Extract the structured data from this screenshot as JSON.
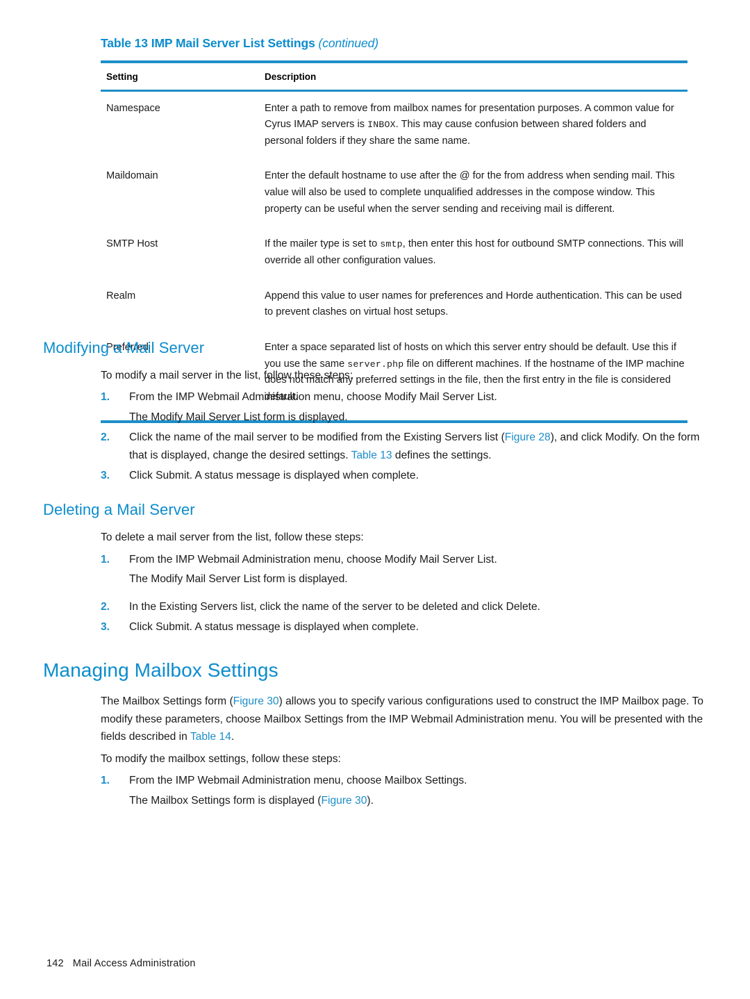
{
  "table": {
    "caption_main": "Table 13 IMP Mail Server List Settings",
    "caption_continued": "(continued)",
    "columns": [
      "Setting",
      "Description"
    ],
    "rows": [
      {
        "setting": "Namespace",
        "desc_part1": "Enter a path to remove from mailbox names for presentation purposes. A common value for Cyrus IMAP servers is ",
        "desc_code": "INBOX",
        "desc_part2": ". This may cause confusion between shared folders and personal folders if they share the same name."
      },
      {
        "setting": "Maildomain",
        "desc_part1": "Enter the default hostname to use after the @ for the from address when sending mail. This value will also be used to complete unqualified addresses in the compose window. This property can be useful when the server sending and receiving mail is different.",
        "desc_code": "",
        "desc_part2": ""
      },
      {
        "setting": "SMTP Host",
        "desc_part1": "If the mailer type is set to ",
        "desc_code": "smtp",
        "desc_part2": ", then enter this host for outbound SMTP connections. This will override all other configuration values."
      },
      {
        "setting": "Realm",
        "desc_part1": "Append this value to user names for preferences and Horde authentication. This can be used to prevent clashes on virtual host setups.",
        "desc_code": "",
        "desc_part2": ""
      },
      {
        "setting": "Preferred",
        "desc_part1": "Enter a space separated list of hosts on which this server entry should be default. Use this if you use the same ",
        "desc_code": "server.php",
        "desc_part2": " file on different machines. If the hostname of the IMP machine does not match any preferred settings in the file, then the first entry in the file is considered default."
      }
    ]
  },
  "modifying": {
    "heading": "Modifying a Mail Server",
    "intro": "To modify a mail server in the list, follow these steps:",
    "step1_num": "1.",
    "step1_text": "From the IMP Webmail Administration menu, choose Modify Mail Server List.",
    "step1_sub": "The Modify Mail Server List form is displayed.",
    "step2_num": "2.",
    "step2_a": "Click the name of the mail server to be modified from the Existing Servers list (",
    "step2_xref1": "Figure 28",
    "step2_b": "), and click Modify. On the form that is displayed, change the desired settings. ",
    "step2_xref2": "Table 13",
    "step2_c": " defines the settings.",
    "step3_num": "3.",
    "step3_text": "Click Submit. A status message is displayed when complete."
  },
  "deleting": {
    "heading": "Deleting a Mail Server",
    "intro": "To delete a mail server from the list, follow these steps:",
    "step1_num": "1.",
    "step1_text": "From the IMP Webmail Administration menu, choose Modify Mail Server List.",
    "step1_sub": "The Modify Mail Server List form is displayed.",
    "step2_num": "2.",
    "step2_text": "In the Existing Servers list, click the name of the server to be deleted and click Delete.",
    "step3_num": "3.",
    "step3_text": "Click Submit. A status message is displayed when complete."
  },
  "managing": {
    "heading": "Managing Mailbox Settings",
    "para_a": "The Mailbox Settings form (",
    "para_xref1": "Figure 30",
    "para_b": ") allows you to specify various configurations used to construct the IMP Mailbox page. To modify these parameters, choose Mailbox Settings from the IMP Webmail Administration menu. You will be presented with the fields described in ",
    "para_xref2": "Table 14",
    "para_c": ".",
    "intro": "To modify the mailbox settings, follow these steps:",
    "step1_num": "1.",
    "step1_text": "From the IMP Webmail Administration menu, choose Mailbox Settings.",
    "step1_sub_a": "The Mailbox Settings form is displayed (",
    "step1_sub_xref": "Figure 30",
    "step1_sub_b": ")."
  },
  "footer": {
    "page_number": "142",
    "book_title": "Mail Access Administration"
  },
  "colors": {
    "accent_blue": "#1c8ec8",
    "heading_blue": "#0b8ccd",
    "text": "#1a1a1a"
  }
}
